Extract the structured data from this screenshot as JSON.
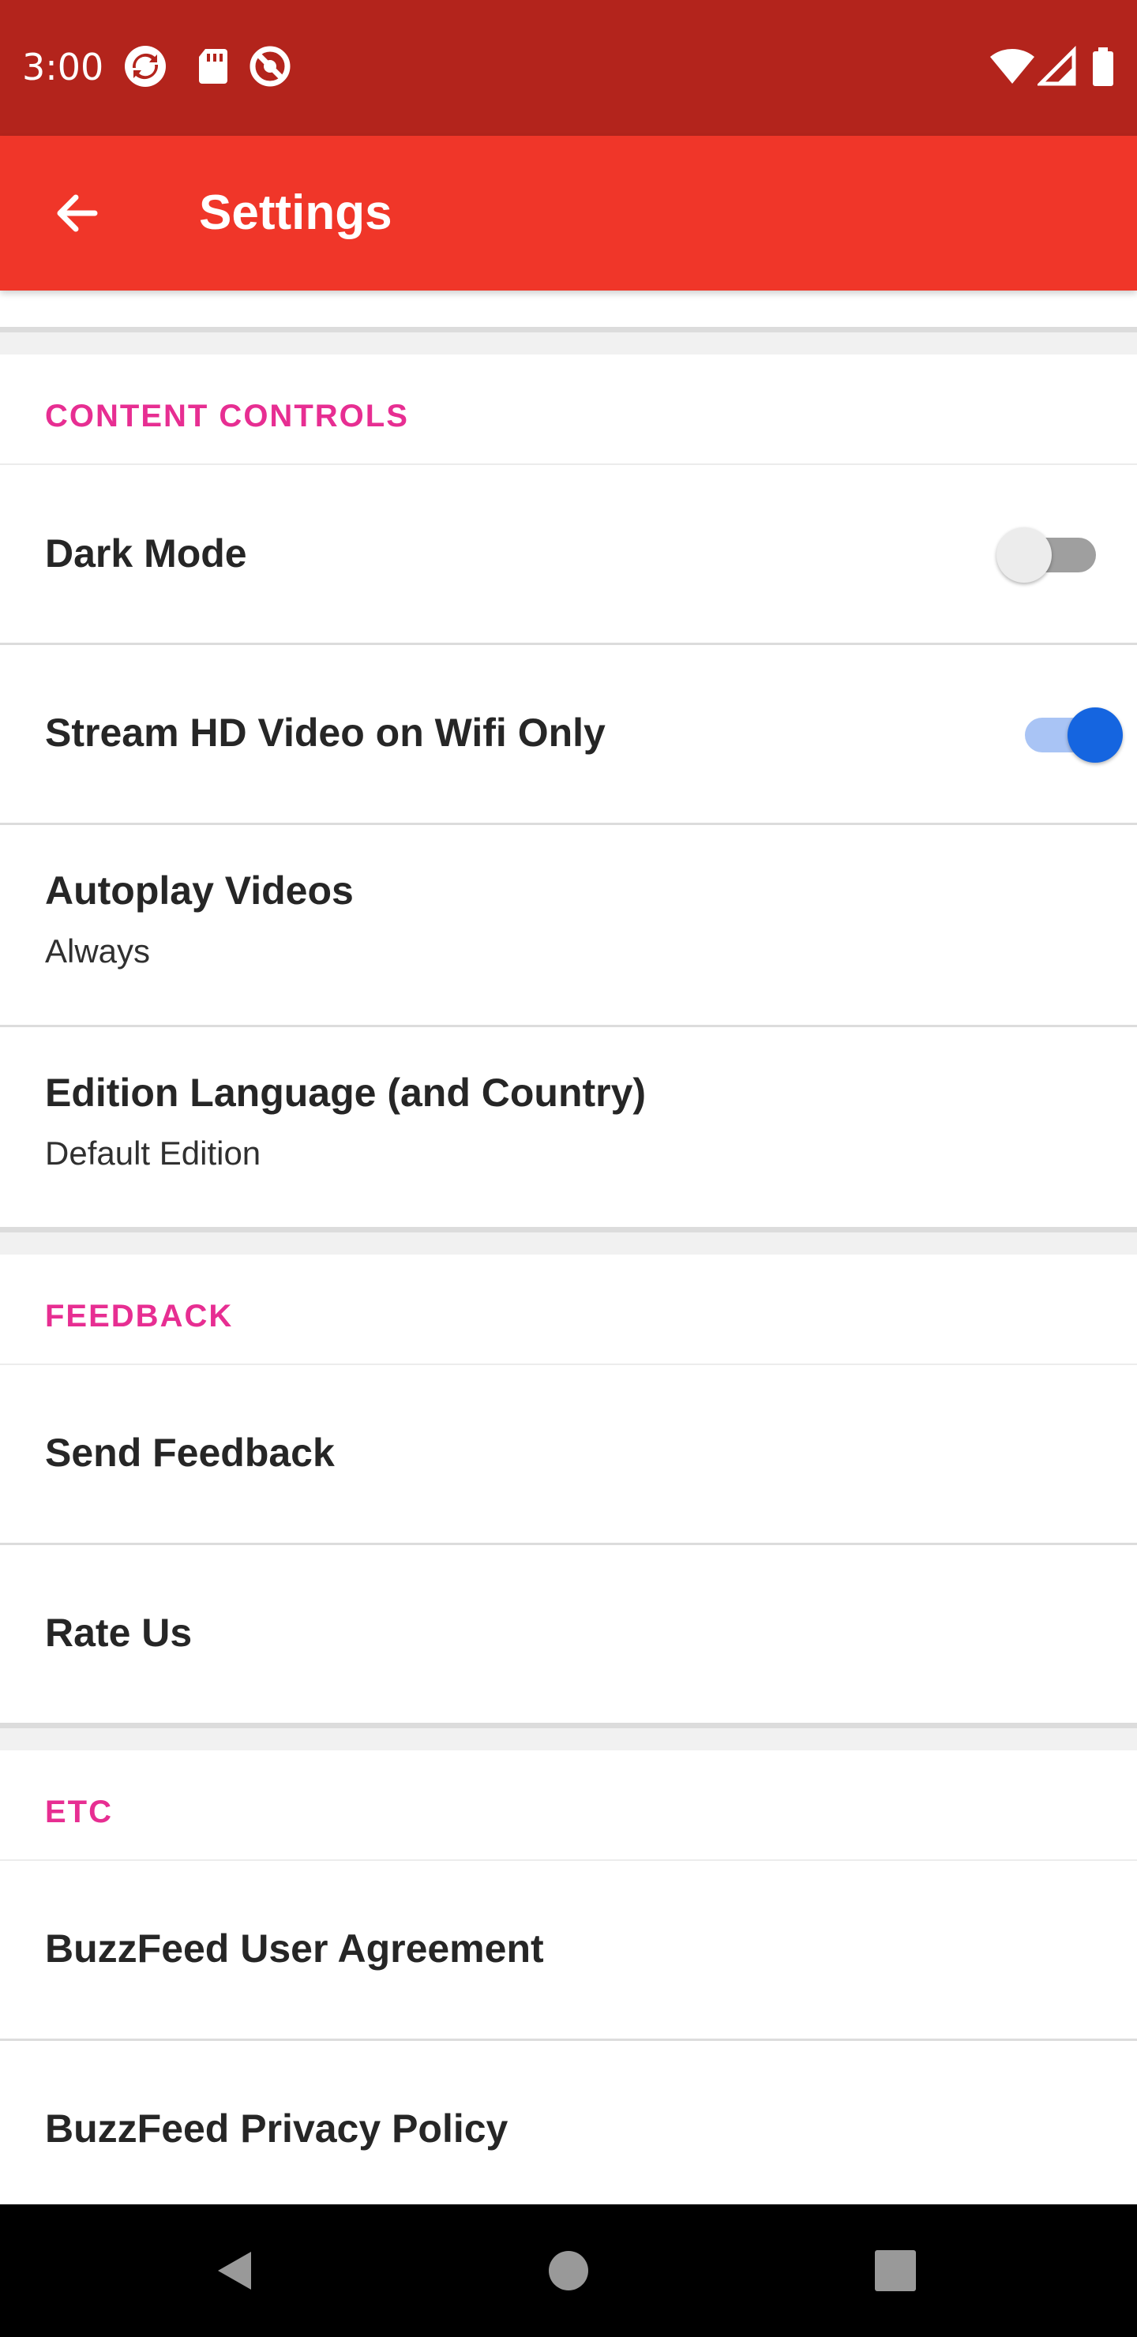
{
  "status_bar": {
    "time": "3:00",
    "left_icons": [
      "sync-icon",
      "sd-card-icon",
      "do-not-disturb-icon"
    ],
    "right_icons": [
      "wifi-icon",
      "signal-icon",
      "battery-icon"
    ]
  },
  "app_bar": {
    "title": "Settings",
    "back_icon": "arrow-back-icon"
  },
  "sections": {
    "content_controls": {
      "header": "CONTENT CONTROLS",
      "dark_mode": {
        "label": "Dark Mode",
        "enabled": false
      },
      "stream_hd": {
        "label": "Stream HD Video on Wifi Only",
        "enabled": true
      },
      "autoplay": {
        "label": "Autoplay Videos",
        "value": "Always"
      },
      "edition": {
        "label": "Edition Language (and Country)",
        "value": "Default Edition"
      }
    },
    "feedback": {
      "header": "FEEDBACK",
      "send_feedback": {
        "label": "Send Feedback"
      },
      "rate_us": {
        "label": "Rate Us"
      }
    },
    "etc": {
      "header": "ETC",
      "user_agreement": {
        "label": "BuzzFeed User Agreement"
      },
      "privacy_policy": {
        "label": "BuzzFeed Privacy Policy"
      }
    }
  },
  "nav_bar": {
    "buttons": [
      "back-triangle-icon",
      "home-circle-icon",
      "recents-square-icon"
    ]
  },
  "colors": {
    "status_bar": "#b3241c",
    "app_bar": "#f03629",
    "section_header": "#e72e92",
    "toggle_on": "#1565e0"
  }
}
